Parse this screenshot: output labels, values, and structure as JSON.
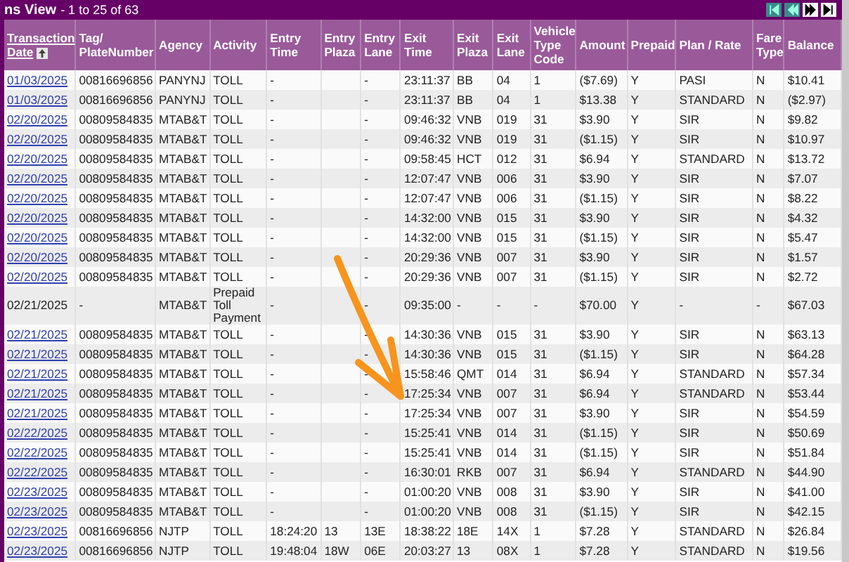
{
  "title_bar": {
    "title": "ns View",
    "range": "- 1 to 25 of 63"
  },
  "pager": [
    {
      "kind": "first",
      "disabled": true
    },
    {
      "kind": "previous",
      "disabled": true
    },
    {
      "kind": "next",
      "disabled": false
    },
    {
      "kind": "last",
      "disabled": false
    }
  ],
  "table": {
    "columns": [
      {
        "label": "Transaction Date",
        "sorted": true
      },
      {
        "label": "Tag/ PlateNumber",
        "sorted": false
      },
      {
        "label": "Agency",
        "sorted": false
      },
      {
        "label": "Activity",
        "sorted": false
      },
      {
        "label": "Entry Time",
        "sorted": false
      },
      {
        "label": "Entry Plaza",
        "sorted": false
      },
      {
        "label": "Entry Lane",
        "sorted": false
      },
      {
        "label": "Exit Time",
        "sorted": false
      },
      {
        "label": "Exit Plaza",
        "sorted": false
      },
      {
        "label": "Exit Lane",
        "sorted": false
      },
      {
        "label": "Vehicle Type Code",
        "sorted": false
      },
      {
        "label": "Amount",
        "sorted": false
      },
      {
        "label": "Prepaid",
        "sorted": false
      },
      {
        "label": "Plan / Rate",
        "sorted": false
      },
      {
        "label": "Fare Type",
        "sorted": false
      },
      {
        "label": "Balance",
        "sorted": false
      }
    ],
    "rows": [
      {
        "link": true,
        "cells": [
          "01/03/2025",
          "00816696856",
          "PANYNJ",
          "TOLL",
          "-",
          "",
          "-",
          "23:11:37",
          "BB",
          "04",
          "1",
          "($7.69)",
          "Y",
          "PASI",
          "N",
          "$10.41"
        ]
      },
      {
        "link": true,
        "cells": [
          "01/03/2025",
          "00816696856",
          "PANYNJ",
          "TOLL",
          "-",
          "",
          "-",
          "23:11:37",
          "BB",
          "04",
          "1",
          "$13.38",
          "Y",
          "STANDARD",
          "N",
          "($2.97)"
        ]
      },
      {
        "link": true,
        "cells": [
          "02/20/2025",
          "00809584835",
          "MTAB&T",
          "TOLL",
          "-",
          "",
          "-",
          "09:46:32",
          "VNB",
          "019",
          "31",
          "$3.90",
          "Y",
          "SIR",
          "N",
          "$9.82"
        ]
      },
      {
        "link": true,
        "cells": [
          "02/20/2025",
          "00809584835",
          "MTAB&T",
          "TOLL",
          "-",
          "",
          "-",
          "09:46:32",
          "VNB",
          "019",
          "31",
          "($1.15)",
          "Y",
          "SIR",
          "N",
          "$10.97"
        ]
      },
      {
        "link": true,
        "cells": [
          "02/20/2025",
          "00809584835",
          "MTAB&T",
          "TOLL",
          "-",
          "",
          "-",
          "09:58:45",
          "HCT",
          "012",
          "31",
          "$6.94",
          "Y",
          "STANDARD",
          "N",
          "$13.72"
        ]
      },
      {
        "link": true,
        "cells": [
          "02/20/2025",
          "00809584835",
          "MTAB&T",
          "TOLL",
          "-",
          "",
          "-",
          "12:07:47",
          "VNB",
          "006",
          "31",
          "$3.90",
          "Y",
          "SIR",
          "N",
          "$7.07"
        ]
      },
      {
        "link": true,
        "cells": [
          "02/20/2025",
          "00809584835",
          "MTAB&T",
          "TOLL",
          "-",
          "",
          "-",
          "12:07:47",
          "VNB",
          "006",
          "31",
          "($1.15)",
          "Y",
          "SIR",
          "N",
          "$8.22"
        ]
      },
      {
        "link": true,
        "cells": [
          "02/20/2025",
          "00809584835",
          "MTAB&T",
          "TOLL",
          "-",
          "",
          "-",
          "14:32:00",
          "VNB",
          "015",
          "31",
          "$3.90",
          "Y",
          "SIR",
          "N",
          "$4.32"
        ]
      },
      {
        "link": true,
        "cells": [
          "02/20/2025",
          "00809584835",
          "MTAB&T",
          "TOLL",
          "-",
          "",
          "-",
          "14:32:00",
          "VNB",
          "015",
          "31",
          "($1.15)",
          "Y",
          "SIR",
          "N",
          "$5.47"
        ]
      },
      {
        "link": true,
        "cells": [
          "02/20/2025",
          "00809584835",
          "MTAB&T",
          "TOLL",
          "-",
          "",
          "-",
          "20:29:36",
          "VNB",
          "007",
          "31",
          "$3.90",
          "Y",
          "SIR",
          "N",
          "$1.57"
        ]
      },
      {
        "link": true,
        "cells": [
          "02/20/2025",
          "00809584835",
          "MTAB&T",
          "TOLL",
          "-",
          "",
          "-",
          "20:29:36",
          "VNB",
          "007",
          "31",
          "($1.15)",
          "Y",
          "SIR",
          "N",
          "$2.72"
        ]
      },
      {
        "link": false,
        "cells": [
          "02/21/2025",
          "-",
          "MTAB&T",
          "Prepaid Toll Payment",
          "-",
          "",
          "-",
          "09:35:00",
          "-",
          "-",
          "-",
          "$70.00",
          "Y",
          "-",
          "-",
          "$67.03"
        ]
      },
      {
        "link": true,
        "cells": [
          "02/21/2025",
          "00809584835",
          "MTAB&T",
          "TOLL",
          "-",
          "",
          "-",
          "14:30:36",
          "VNB",
          "015",
          "31",
          "$3.90",
          "Y",
          "SIR",
          "N",
          "$63.13"
        ]
      },
      {
        "link": true,
        "cells": [
          "02/21/2025",
          "00809584835",
          "MTAB&T",
          "TOLL",
          "-",
          "",
          "-",
          "14:30:36",
          "VNB",
          "015",
          "31",
          "($1.15)",
          "Y",
          "SIR",
          "N",
          "$64.28"
        ]
      },
      {
        "link": true,
        "cells": [
          "02/21/2025",
          "00809584835",
          "MTAB&T",
          "TOLL",
          "-",
          "",
          "-",
          "15:58:46",
          "QMT",
          "014",
          "31",
          "$6.94",
          "Y",
          "STANDARD",
          "N",
          "$57.34"
        ]
      },
      {
        "link": true,
        "cells": [
          "02/21/2025",
          "00809584835",
          "MTAB&T",
          "TOLL",
          "-",
          "",
          "-",
          "17:25:34",
          "VNB",
          "007",
          "31",
          "$6.94",
          "Y",
          "STANDARD",
          "N",
          "$53.44"
        ]
      },
      {
        "link": true,
        "cells": [
          "02/21/2025",
          "00809584835",
          "MTAB&T",
          "TOLL",
          "-",
          "",
          "-",
          "17:25:34",
          "VNB",
          "007",
          "31",
          "$3.90",
          "Y",
          "SIR",
          "N",
          "$54.59"
        ]
      },
      {
        "link": true,
        "cells": [
          "02/22/2025",
          "00809584835",
          "MTAB&T",
          "TOLL",
          "-",
          "",
          "-",
          "15:25:41",
          "VNB",
          "014",
          "31",
          "($1.15)",
          "Y",
          "SIR",
          "N",
          "$50.69"
        ]
      },
      {
        "link": true,
        "cells": [
          "02/22/2025",
          "00809584835",
          "MTAB&T",
          "TOLL",
          "-",
          "",
          "-",
          "15:25:41",
          "VNB",
          "014",
          "31",
          "($1.15)",
          "Y",
          "SIR",
          "N",
          "$51.84"
        ]
      },
      {
        "link": true,
        "cells": [
          "02/22/2025",
          "00809584835",
          "MTAB&T",
          "TOLL",
          "-",
          "",
          "-",
          "16:30:01",
          "RKB",
          "007",
          "31",
          "$6.94",
          "Y",
          "STANDARD",
          "N",
          "$44.90"
        ]
      },
      {
        "link": true,
        "cells": [
          "02/23/2025",
          "00809584835",
          "MTAB&T",
          "TOLL",
          "-",
          "",
          "-",
          "01:00:20",
          "VNB",
          "008",
          "31",
          "$3.90",
          "Y",
          "SIR",
          "N",
          "$41.00"
        ]
      },
      {
        "link": true,
        "cells": [
          "02/23/2025",
          "00809584835",
          "MTAB&T",
          "TOLL",
          "-",
          "",
          "-",
          "01:00:20",
          "VNB",
          "008",
          "31",
          "($1.15)",
          "Y",
          "SIR",
          "N",
          "$42.15"
        ]
      },
      {
        "link": true,
        "cells": [
          "02/23/2025",
          "00816696856",
          "NJTP",
          "TOLL",
          "18:24:20",
          "13",
          "13E",
          "18:38:22",
          "18E",
          "14X",
          "1",
          "$7.28",
          "Y",
          "STANDARD",
          "N",
          "$26.84"
        ]
      },
      {
        "link": true,
        "cells": [
          "02/23/2025",
          "00816696856",
          "NJTP",
          "TOLL",
          "19:48:04",
          "18W",
          "06E",
          "20:03:27",
          "13",
          "08X",
          "1",
          "$7.28",
          "Y",
          "STANDARD",
          "N",
          "$19.56"
        ]
      }
    ]
  }
}
